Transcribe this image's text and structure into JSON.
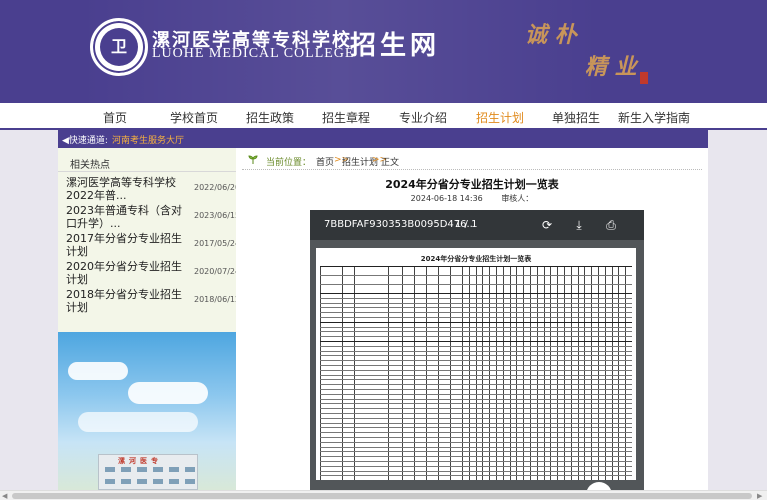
{
  "header": {
    "college_name_cn": "漯河医学高等专科学校",
    "college_name_en": "LUOHE MEDICAL COLLEGE",
    "site_title": "招生网",
    "calligraphy_line1": "诚 朴",
    "calligraphy_line2": "精 业",
    "brand_color": "#4a3f8f",
    "accent_color": "#e08a1c"
  },
  "nav": {
    "items": [
      {
        "label": "首页"
      },
      {
        "label": "学校首页"
      },
      {
        "label": "招生政策"
      },
      {
        "label": "招生章程"
      },
      {
        "label": "专业介绍"
      },
      {
        "label": "招生计划",
        "active": true
      },
      {
        "label": "单独招生"
      },
      {
        "label": "新生入学指南"
      }
    ]
  },
  "quick_access": {
    "label": "◀快速通道:",
    "link": "河南考生服务大厅"
  },
  "sidebar": {
    "hot_title": "相关热点",
    "items": [
      {
        "title": "漯河医学高等专科学校2022年普...",
        "date": "2022/06/20"
      },
      {
        "title": "2023年普通专科（含对口升学）...",
        "date": "2023/06/15"
      },
      {
        "title": "2017年分省分专业招生计划",
        "date": "2017/05/24"
      },
      {
        "title": "2020年分省分专业招生计划",
        "date": "2020/07/24"
      },
      {
        "title": "2018年分省分专业招生计划",
        "date": "2018/06/12"
      }
    ],
    "campus_sign": "漯河医专"
  },
  "breadcrumb": {
    "label": "当前位置：",
    "items": [
      "首页",
      "招生计划",
      "正文"
    ],
    "separator": ">>"
  },
  "article": {
    "title": "2024年分省分专业招生计划一览表",
    "datetime": "2024-06-18 14:36",
    "reviewer_label": "审核人："
  },
  "pdf_viewer": {
    "file_name": "7BBDFAF930353B0095D476...",
    "page_indicator": "1 / 1",
    "icons": [
      "rotate-icon",
      "download-icon",
      "print-icon"
    ],
    "sheet_title": "2024年分省分专业招生计划一览表"
  }
}
